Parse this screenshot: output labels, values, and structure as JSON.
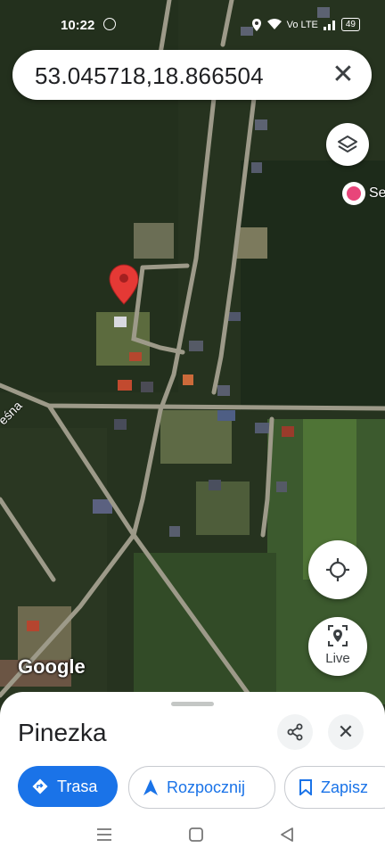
{
  "status_bar": {
    "time": "10:22",
    "network": "Vo LTE",
    "battery": "49"
  },
  "search": {
    "query": "53.045718,18.866504"
  },
  "map": {
    "nearby_place_label": "Se",
    "road_label": "eśna",
    "attribution": "Google"
  },
  "controls": {
    "live_label": "Live"
  },
  "sheet": {
    "title": "Pinezka",
    "actions": {
      "directions": "Trasa",
      "start": "Rozpocznij",
      "save": "Zapisz"
    }
  },
  "colors": {
    "accent": "#1a73e8",
    "pin": "#e53935",
    "place_icon": "#e8457a"
  },
  "icons": [
    "check-circle-icon",
    "location-icon",
    "wifi-icon",
    "signal-icon",
    "battery-icon",
    "close-icon",
    "layers-icon",
    "heart-icon",
    "map-pin-icon",
    "my-location-icon",
    "live-view-icon",
    "share-icon",
    "directions-icon",
    "navigation-icon",
    "bookmark-icon",
    "recent-apps-icon",
    "home-icon",
    "back-icon"
  ]
}
